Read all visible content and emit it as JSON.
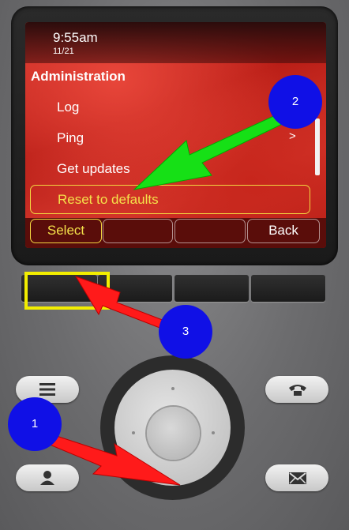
{
  "screen": {
    "time": "9:55am",
    "date": "11/21",
    "menu_title": "Administration",
    "items": [
      {
        "label": "Log"
      },
      {
        "label": "Ping"
      },
      {
        "label": "Get updates"
      },
      {
        "label": "Reset to defaults"
      }
    ],
    "submenu_indicator": ">",
    "selected_item": "Reset to defaults"
  },
  "softkeys": [
    "Select",
    "",
    "",
    "Back"
  ],
  "icons": {
    "menu_key": "menu-lines-icon",
    "phone_key": "handset-icon",
    "contacts_key": "person-icon",
    "messages_key": "envelope-icon"
  },
  "annotations": {
    "step_1": "1",
    "step_2": "2",
    "step_3": "3",
    "colors": {
      "arrow_1": "#ff1a1a",
      "arrow_2": "#16e016",
      "arrow_3": "#ff1a1a",
      "badge": "#1010e6",
      "highlight": "#f3ee00"
    }
  }
}
